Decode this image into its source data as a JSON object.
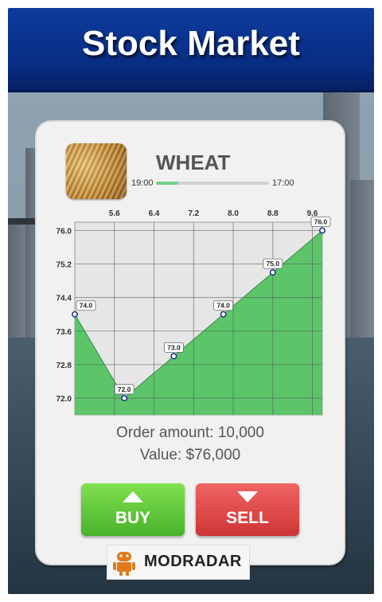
{
  "header": {
    "title": "Stock Market"
  },
  "commodity": {
    "name": "WHEAT",
    "image": "wheat-photo",
    "time_start": "19:00",
    "time_end": "17:00",
    "time_progress": 0.2
  },
  "chart_data": {
    "type": "area",
    "x_ticks": [
      "5.6",
      "6.4",
      "7.2",
      "8.0",
      "8.8",
      "9.6"
    ],
    "y_ticks": [
      "76.0",
      "75.2",
      "74.4",
      "73.6",
      "72.8",
      "72.0"
    ],
    "xlim": [
      4.8,
      9.8
    ],
    "ylim": [
      71.6,
      76.2
    ],
    "x": [
      4.8,
      5.8,
      6.8,
      7.8,
      8.8,
      9.8
    ],
    "values": [
      74.0,
      72.0,
      73.0,
      74.0,
      75.0,
      76.0
    ],
    "point_labels": [
      "74.0",
      "72.0",
      "73.0",
      "74.0",
      "75.0",
      "76.0"
    ],
    "grid": true,
    "fill_color": "#5cc56a",
    "line_color": "#3a8a47"
  },
  "order": {
    "amount_text": "Order amount: 10,000",
    "value_text": "Value: $76,000"
  },
  "actions": {
    "buy_label": "BUY",
    "sell_label": "SELL",
    "buy_color": "#5ec63a",
    "sell_color": "#e04848"
  },
  "watermark": {
    "text": "MODRADAR",
    "icon": "android-robot-icon"
  }
}
